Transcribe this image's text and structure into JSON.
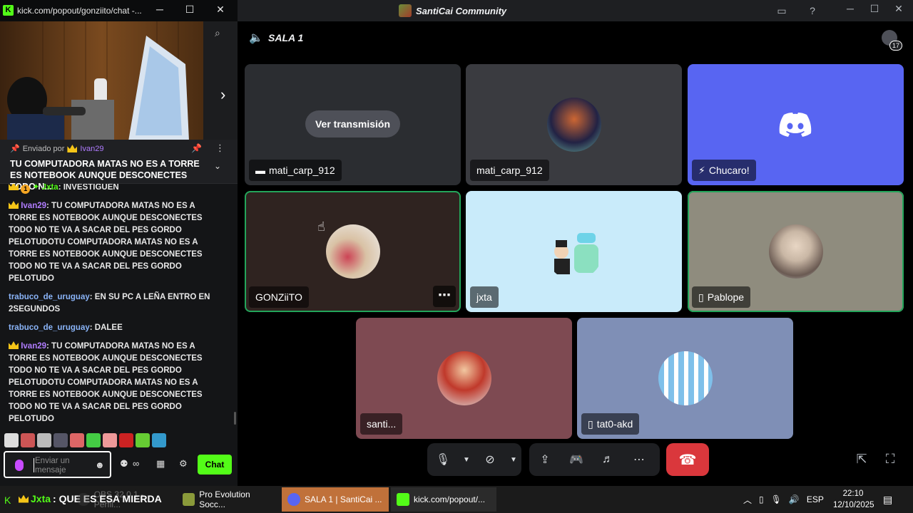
{
  "kick": {
    "window_title": "kick.com/popout/gonziito/chat -...",
    "pinned": {
      "sent_by_label": "Enviado por",
      "user": "Ivan29",
      "text": "TU COMPUTADORA MATAS NO ES A TORRE ES NOTEBOOK AUNQUE DESCONECTES TODO N..."
    },
    "messages": [
      {
        "badges": [
          "crown",
          "coin",
          "star"
        ],
        "user": "Jxta",
        "user_color": "green",
        "text": "INVESTIGUEN"
      },
      {
        "badges": [
          "crown"
        ],
        "user": "Ivan29",
        "user_color": "purple",
        "text": "TU COMPUTADORA MATAS NO ES A TORRE ES NOTEBOOK AUNQUE DESCONECTES TODO NO TE VA A SACAR DEL PES GORDO PELOTUDOTU COMPUTADORA MATAS NO ES A TORRE ES NOTEBOOK AUNQUE DESCONECTES TODO NO TE VA A SACAR DEL PES GORDO PELOTUDO"
      },
      {
        "badges": [],
        "user": "trabuco_de_uruguay",
        "user_color": "blue",
        "text": "EN SU PC A LEÑA ENTRO EN 2SEGUNDOS"
      },
      {
        "badges": [],
        "user": "trabuco_de_uruguay",
        "user_color": "blue",
        "text": "DALEE"
      },
      {
        "badges": [
          "crown"
        ],
        "user": "Ivan29",
        "user_color": "purple",
        "text": "TU COMPUTADORA MATAS NO ES A TORRE ES NOTEBOOK AUNQUE DESCONECTES TODO NO TE VA A SACAR DEL PES GORDO PELOTUDOTU COMPUTADORA MATAS NO ES A TORRE ES NOTEBOOK AUNQUE DESCONECTES TODO NO TE VA A SACAR DEL PES GORDO PELOTUDO"
      },
      {
        "badges": [
          "crown",
          "coin",
          "star"
        ],
        "user": "Jxta",
        "user_color": "green",
        "text": "QUE ES ESA MIERDA"
      }
    ],
    "input_placeholder": "Enviar un mensaje",
    "send_label": "Chat",
    "colors": {
      "accent": "#53fc18",
      "bg": "#141517"
    }
  },
  "discord": {
    "window_title": "SantiCai Community",
    "channel": "SALA 1",
    "member_count": "17",
    "tiles": [
      {
        "id": "t1",
        "name": "mati_carp_912",
        "status_icon": "screen-share-icon",
        "button": "Ver transmisión"
      },
      {
        "id": "t2",
        "name": "mati_carp_912"
      },
      {
        "id": "t3",
        "name": "Chucaro!",
        "status_icon": "muted-icon"
      },
      {
        "id": "t4",
        "name": "GONZiiTO",
        "speaking": true
      },
      {
        "id": "t5",
        "name": "jxta"
      },
      {
        "id": "t6",
        "name": "Pablope",
        "status_icon": "mobile-icon",
        "speaking": true
      },
      {
        "id": "t7",
        "name": "santi..."
      },
      {
        "id": "t8",
        "name": "tat0-akd",
        "status_icon": "mobile-icon"
      }
    ],
    "colors": {
      "blurple": "#5865f2",
      "hangup": "#da373c",
      "speaking": "#23a55a"
    }
  },
  "taskbar": {
    "ticker_user": "Jxta",
    "ticker_text": ": QUE ES ESA MIERDA",
    "tasks": [
      {
        "label": "OBS 32.0.1 - Perfil..."
      },
      {
        "label": "Pro Evolution Socc..."
      },
      {
        "label": "SALA 1 | SantiCai ..."
      },
      {
        "label": "kick.com/popout/..."
      }
    ],
    "lang": "ESP",
    "time": "22:10",
    "date": "12/10/2025"
  }
}
